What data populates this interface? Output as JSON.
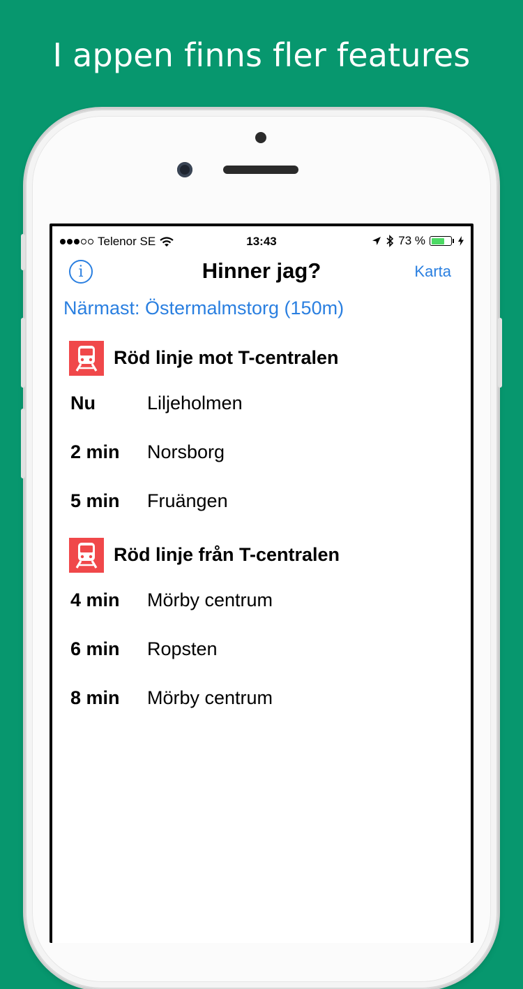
{
  "promo": {
    "headline": "I appen finns fler features"
  },
  "colors": {
    "background": "#07976e",
    "accent": "#2a7fe0",
    "metro_red": "#f0484a",
    "battery_green": "#4cd964"
  },
  "status_bar": {
    "carrier": "Telenor SE",
    "signal_bars": 5,
    "signal_filled": 3,
    "time": "13:43",
    "battery_percent": "73 %",
    "battery_level": 0.73,
    "icons": [
      "wifi-icon",
      "location-arrow-icon",
      "bluetooth-icon",
      "battery-icon",
      "charging-icon"
    ]
  },
  "nav": {
    "title": "Hinner jag?",
    "right_button": "Karta",
    "left_icon": "info-icon"
  },
  "nearest": "Närmast: Östermalmstorg (150m)",
  "sections": [
    {
      "title": "Röd linje mot T-centralen",
      "icon": "metro-train-icon",
      "departures": [
        {
          "time": "Nu",
          "destination": "Liljeholmen"
        },
        {
          "time": "2 min",
          "destination": "Norsborg"
        },
        {
          "time": "5 min",
          "destination": "Fruängen"
        }
      ]
    },
    {
      "title": "Röd linje från T-centralen",
      "icon": "metro-train-icon",
      "departures": [
        {
          "time": "4 min",
          "destination": "Mörby centrum"
        },
        {
          "time": "6 min",
          "destination": "Ropsten"
        },
        {
          "time": "8 min",
          "destination": "Mörby centrum"
        }
      ]
    }
  ]
}
